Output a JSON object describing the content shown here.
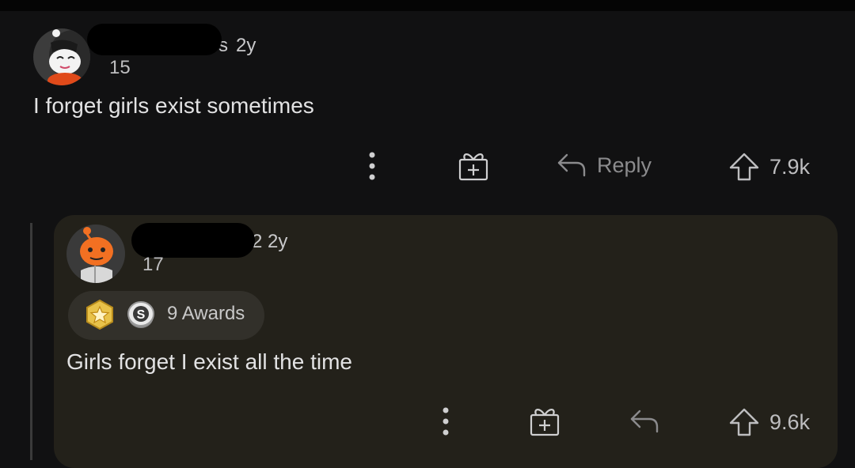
{
  "top_comment": {
    "age": "2y",
    "username_tail": "s",
    "flair_score": "15",
    "body": "I forget girls exist sometimes",
    "actions": {
      "more_icon": "more-vertical-icon",
      "award_icon": "gift-icon",
      "reply_label": "Reply",
      "vote_count": "7.9k"
    }
  },
  "reply_comment": {
    "age": "2y",
    "username_tail": "2",
    "flair_score": "17",
    "awards_label": "9 Awards",
    "body": "Girls forget I exist all the time",
    "actions": {
      "more_icon": "more-vertical-icon",
      "award_icon": "gift-icon",
      "reply_icon": "reply-arrow-icon",
      "vote_count": "9.6k"
    }
  },
  "colors": {
    "background": "#111112",
    "reply_card": "#23211a",
    "text": "#e2e2e3",
    "muted": "#8b8b8d"
  }
}
